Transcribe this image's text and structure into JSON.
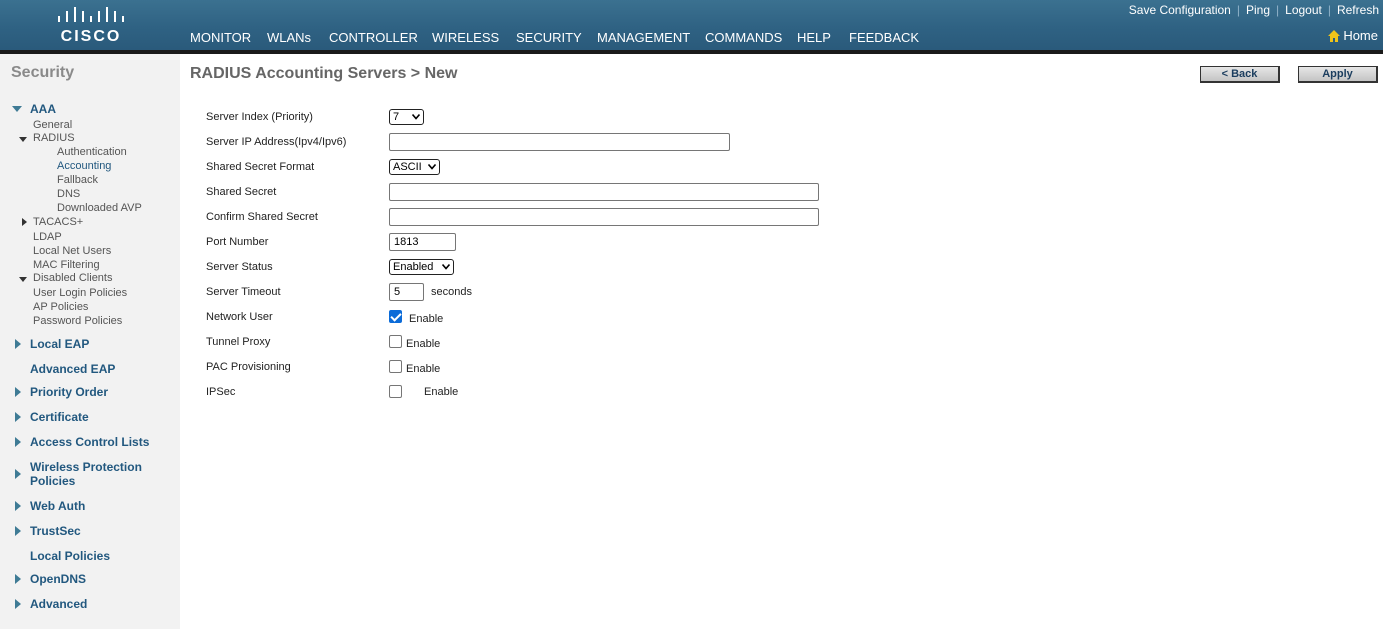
{
  "brand": {
    "logo_text": "CISCO",
    "primary_color": "#2f6283",
    "accent_color": "#f0a019"
  },
  "toplinks": [
    "Save Configuration",
    "Ping",
    "Logout",
    "Refresh"
  ],
  "nav": [
    "MONITOR",
    "WLANs",
    "CONTROLLER",
    "WIRELESS",
    "SECURITY",
    "MANAGEMENT",
    "COMMANDS",
    "HELP",
    "FEEDBACK"
  ],
  "nav_active": "SECURITY",
  "home": {
    "label": "Home",
    "icon": "home-icon"
  },
  "sidebar": {
    "title": "Security",
    "aaa": {
      "label": "AAA",
      "items": {
        "general": "General",
        "radius": "RADIUS",
        "authentication": "Authentication",
        "accounting": "Accounting",
        "fallback": "Fallback",
        "dns": "DNS",
        "downloaded_avp": "Downloaded AVP",
        "tacacs": "TACACS+",
        "ldap": "LDAP",
        "local_net_users": "Local Net Users",
        "mac_filtering": "MAC Filtering",
        "disabled_clients": "Disabled Clients",
        "user_login_policies": "User Login Policies",
        "ap_policies": "AP Policies",
        "password_policies": "Password Policies"
      }
    },
    "sections": {
      "local_eap": "Local EAP",
      "advanced_eap": "Advanced EAP",
      "priority_order": "Priority Order",
      "certificate": "Certificate",
      "acl": "Access Control Lists",
      "wpp_line1": "Wireless Protection",
      "wpp_line2": "Policies",
      "web_auth": "Web Auth",
      "trustsec": "TrustSec",
      "local_policies": "Local Policies",
      "opendns": "OpenDNS",
      "advanced": "Advanced"
    }
  },
  "page": {
    "title": "RADIUS Accounting Servers > New",
    "back_button": "< Back",
    "apply_button": "Apply"
  },
  "form": {
    "server_index": {
      "label": "Server Index (Priority)",
      "value": "7"
    },
    "server_ip": {
      "label": "Server IP Address(Ipv4/Ipv6)",
      "value": ""
    },
    "secret_format": {
      "label": "Shared Secret Format",
      "value": "ASCII"
    },
    "shared_secret": {
      "label": "Shared Secret",
      "value": ""
    },
    "confirm_secret": {
      "label": "Confirm Shared Secret",
      "value": ""
    },
    "port_number": {
      "label": "Port Number",
      "value": "1813"
    },
    "server_status": {
      "label": "Server Status",
      "value": "Enabled"
    },
    "server_timeout": {
      "label": "Server Timeout",
      "value": "5",
      "unit": "seconds"
    },
    "network_user": {
      "label": "Network User",
      "checked": true,
      "option": "Enable"
    },
    "tunnel_proxy": {
      "label": "Tunnel Proxy",
      "checked": false,
      "option": "Enable"
    },
    "pac_provisioning": {
      "label": "PAC Provisioning",
      "checked": false,
      "option": "Enable"
    },
    "ipsec": {
      "label": "IPSec",
      "checked": false,
      "option": "Enable"
    }
  }
}
